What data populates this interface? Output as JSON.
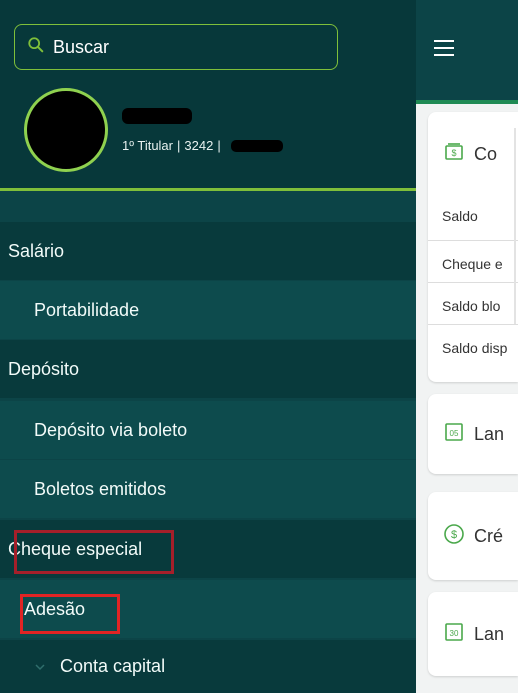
{
  "drawer": {
    "search_placeholder": "Buscar",
    "user": {
      "meta_titular": "1º Titular",
      "meta_agency": "3242",
      "meta_sep": "|"
    },
    "menu": [
      {
        "label": "Salário",
        "level": "top"
      },
      {
        "label": "Portabilidade",
        "level": "sub"
      },
      {
        "label": "Depósito",
        "level": "top"
      },
      {
        "label": "Depósito via boleto",
        "level": "sub"
      },
      {
        "label": "Boletos emitidos",
        "level": "sub"
      },
      {
        "label": "Cheque especial",
        "level": "top"
      },
      {
        "label": "Adesão",
        "level": "sub"
      },
      {
        "label": "Conta capital",
        "level": "top"
      }
    ]
  },
  "main": {
    "cards": [
      {
        "title": "Co",
        "icon": "money-icon"
      },
      {
        "title": "Lan",
        "icon": "calendar-05-icon"
      },
      {
        "title": "Cré",
        "icon": "dollar-circle-icon"
      },
      {
        "title": "Lan",
        "icon": "calendar-30-icon"
      }
    ],
    "balance_rows": [
      "Saldo",
      "Cheque e",
      "Saldo blo",
      "Saldo disp"
    ]
  },
  "colors": {
    "drawer_bg": "#0c4447",
    "accent_green": "#7fbf3a",
    "highlight_red": "#a51f2a"
  }
}
